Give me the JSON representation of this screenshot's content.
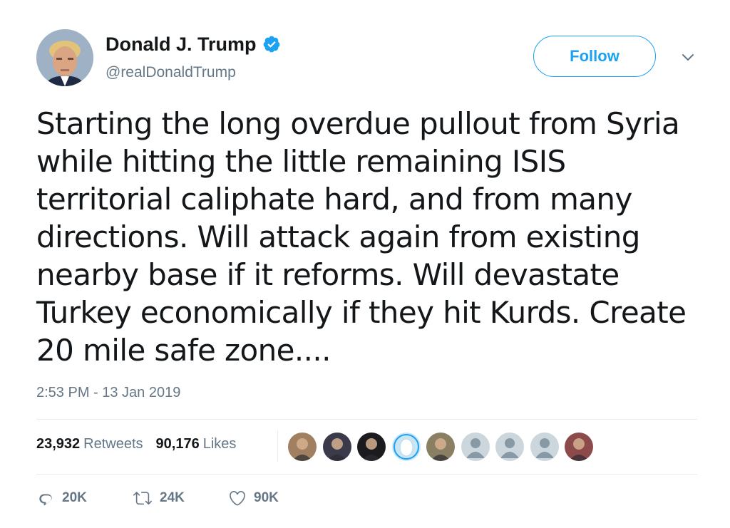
{
  "author": {
    "display_name": "Donald J. Trump",
    "handle": "@realDonaldTrump",
    "verified": true
  },
  "follow_label": "Follow",
  "tweet": {
    "lines": [
      "Starting the long overdue pullout from Syria",
      "while hitting the little remaining ISIS",
      "territorial caliphate hard, and from many",
      "directions. Will attack again from existing",
      "nearby base if it reforms. Will devastate",
      "Turkey economically if they hit Kurds. Create",
      "20 mile safe zone...."
    ],
    "timestamp": "2:53 PM - 13 Jan 2019"
  },
  "stats": {
    "retweets_count": "23,932",
    "retweets_label": "Retweets",
    "likes_count": "90,176",
    "likes_label": "Likes"
  },
  "likers": [
    {
      "icon": "user-avatar-photo",
      "color": "#a08060"
    },
    {
      "icon": "user-avatar-photo",
      "color": "#3a3a4a"
    },
    {
      "icon": "user-avatar-photo",
      "color": "#1b1b1f"
    },
    {
      "icon": "egg-avatar",
      "color": "#c9e6f7"
    },
    {
      "icon": "user-avatar-photo",
      "color": "#8a7e63"
    },
    {
      "icon": "default-avatar",
      "color": "#ccd6dd"
    },
    {
      "icon": "default-avatar",
      "color": "#ccd6dd"
    },
    {
      "icon": "default-avatar",
      "color": "#ccd6dd"
    },
    {
      "icon": "user-avatar-photo",
      "color": "#8c4a4a"
    }
  ],
  "actions": {
    "reply_count": "20K",
    "retweet_count": "24K",
    "like_count": "90K"
  },
  "colors": {
    "accent": "#1da1f2",
    "text": "#14171a",
    "secondary": "#657786",
    "divider": "#e6ecf0"
  }
}
